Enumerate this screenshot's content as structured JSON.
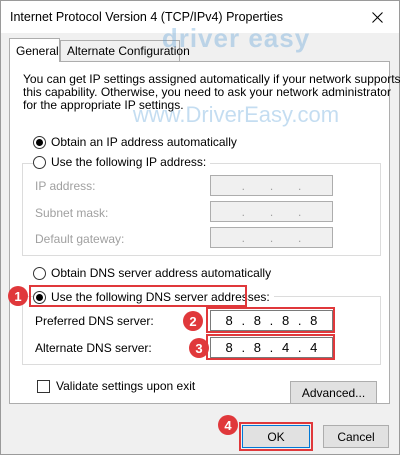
{
  "window": {
    "title": "Internet Protocol Version 4 (TCP/IPv4) Properties"
  },
  "tabs": [
    {
      "label": "General"
    },
    {
      "label": "Alternate Configuration"
    }
  ],
  "description": {
    "lines": [
      "You can get IP settings assigned automatically if your network supports",
      "this capability. Otherwise, you need to ask your network administrator",
      "for the appropriate IP settings."
    ]
  },
  "watermark": {
    "logo": "driver easy",
    "url": "www.DriverEasy.com"
  },
  "ip": {
    "auto_label": "Obtain an IP address automatically",
    "manual_label": "Use the following IP address:",
    "selected": "auto",
    "fields": [
      {
        "label": "IP address:",
        "octets": [
          "",
          "",
          "",
          ""
        ]
      },
      {
        "label": "Subnet mask:",
        "octets": [
          "",
          "",
          "",
          ""
        ]
      },
      {
        "label": "Default gateway:",
        "octets": [
          "",
          "",
          "",
          ""
        ]
      }
    ]
  },
  "dns": {
    "auto_label": "Obtain DNS server address automatically",
    "manual_label": "Use the following DNS server addresses:",
    "selected": "manual",
    "preferred": {
      "label": "Preferred DNS server:",
      "octets": [
        "8",
        "8",
        "8",
        "8"
      ]
    },
    "alternate": {
      "label": "Alternate DNS server:",
      "octets": [
        "8",
        "8",
        "4",
        "4"
      ]
    }
  },
  "validate_label": "Validate settings upon exit",
  "buttons": {
    "advanced": "Advanced...",
    "ok": "OK",
    "cancel": "Cancel"
  },
  "annotations": {
    "step1": "1",
    "step2": "2",
    "step3": "3",
    "step4": "4",
    "color": "#e0383b"
  }
}
